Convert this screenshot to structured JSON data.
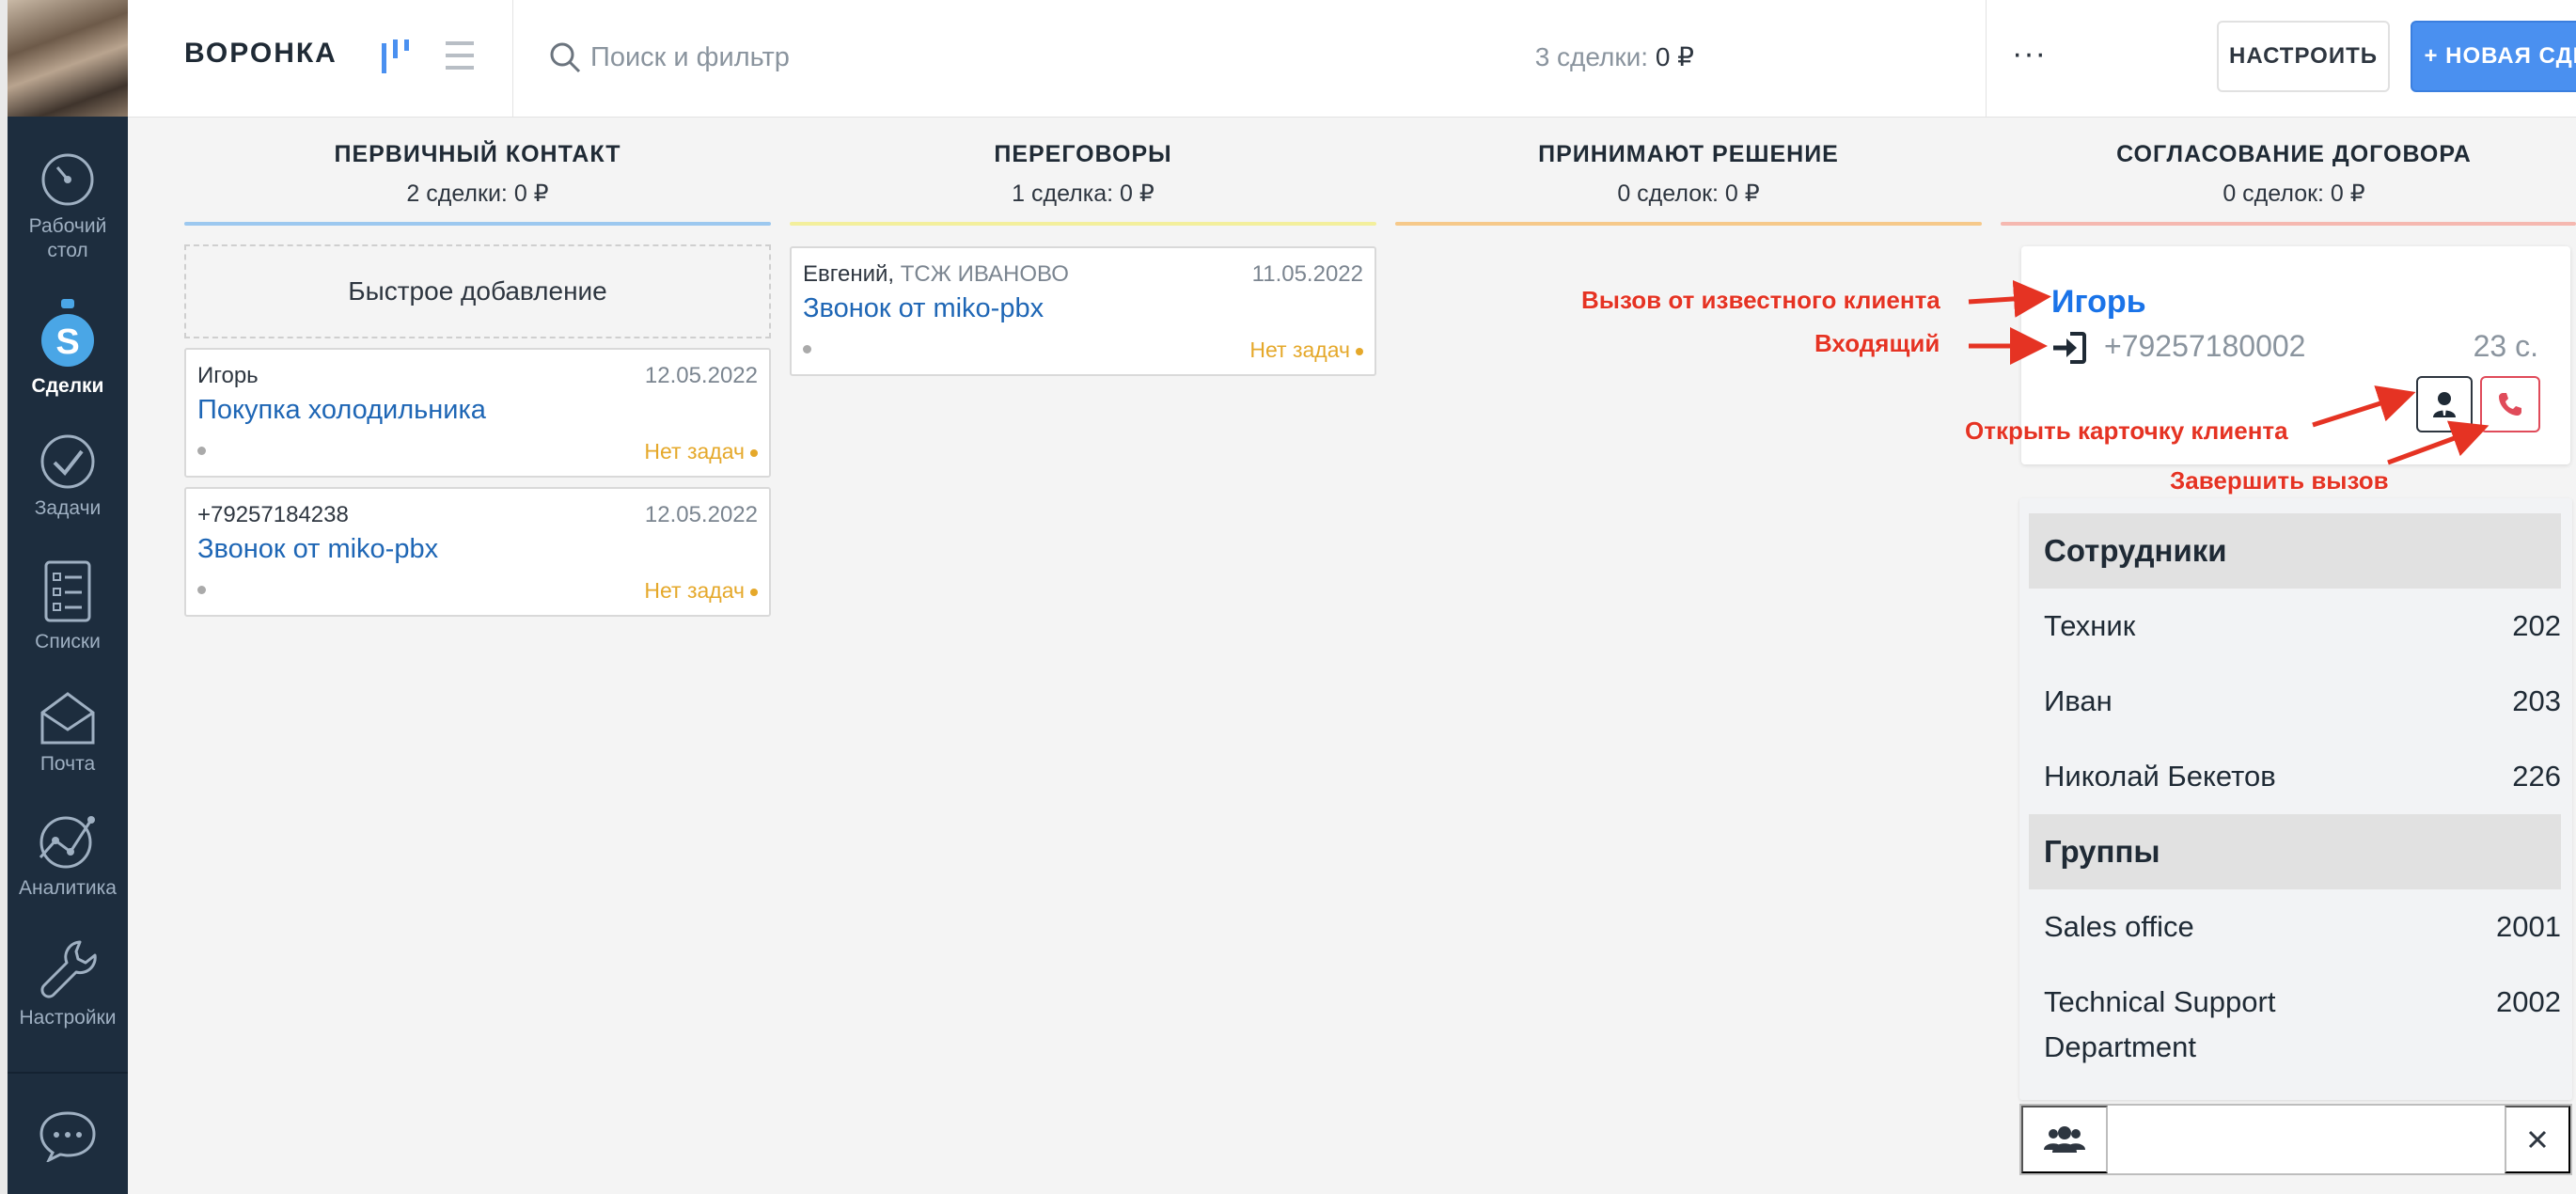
{
  "nav": {
    "items": [
      {
        "label_line1": "Рабочий",
        "label_line2": "стол"
      },
      {
        "label": "Сделки"
      },
      {
        "label": "Задачи"
      },
      {
        "label": "Списки"
      },
      {
        "label": "Почта"
      },
      {
        "label": "Аналитика"
      },
      {
        "label": "Настройки"
      }
    ],
    "active": "Сделки"
  },
  "topbar": {
    "title": "ВОРОНКА",
    "search_placeholder": "Поиск и фильтр",
    "summary_prefix": "3 сделки:",
    "summary_value": "0 ₽",
    "more_label": "···",
    "config_button": "НАСТРОИТЬ",
    "new_button": "+ НОВАЯ СДЕЛКА"
  },
  "columns": [
    {
      "name": "ПЕРВИЧНЫЙ КОНТАКТ",
      "summary": "2 сделки: 0 ₽",
      "color": "#9cc8ef"
    },
    {
      "name": "ПЕРЕГОВОРЫ",
      "summary": "1 сделка: 0 ₽",
      "color": "#f3ef9c"
    },
    {
      "name": "ПРИНИМАЮТ РЕШЕНИЕ",
      "summary": "0 сделок: 0 ₽",
      "color": "#f6c98a"
    },
    {
      "name": "СОГЛАСОВАНИЕ ДОГОВОРА",
      "summary": "0 сделок: 0 ₽",
      "color": "#f5b8b0"
    }
  ],
  "quick_add": "Быстрое добавление",
  "deals": [
    {
      "contact": "Игорь",
      "company": "",
      "date": "12.05.2022",
      "title": "Покупка холодильника",
      "tasks": "Нет задач"
    },
    {
      "contact": "+79257184238",
      "company": "",
      "date": "12.05.2022",
      "title": "Звонок от miko-pbx",
      "tasks": "Нет задач"
    },
    {
      "contact": "Евгений,",
      "company": "ТСЖ ИВАНОВО",
      "date": "11.05.2022",
      "title": "Звонок от miko-pbx",
      "tasks": "Нет задач"
    }
  ],
  "call": {
    "name": "Игорь",
    "number": "+79257180002",
    "timer": "23 с."
  },
  "directory": {
    "employees_header": "Сотрудники",
    "employees": [
      {
        "name": "Техник",
        "ext": "202"
      },
      {
        "name": "Иван",
        "ext": "203"
      },
      {
        "name": "Николай Бекетов",
        "ext": "226"
      }
    ],
    "groups_header": "Группы",
    "groups": [
      {
        "name": "Sales office",
        "ext": "2001"
      },
      {
        "name_line1": "Technical Support",
        "name_line2": "Department",
        "ext": "2002"
      }
    ]
  },
  "annotations": {
    "known_client": "Вызов от известного клиента",
    "incoming": "Входящий",
    "open_card": "Открыть карточку клиента",
    "end_call": "Завершить вызов"
  },
  "colors": {
    "accent": "#4a90f0",
    "link": "#1e66b5",
    "no_tasks": "#e5a82a",
    "annotation": "#e53323",
    "hangup": "#e04b5a",
    "nav_bg": "#1d2d3e"
  }
}
